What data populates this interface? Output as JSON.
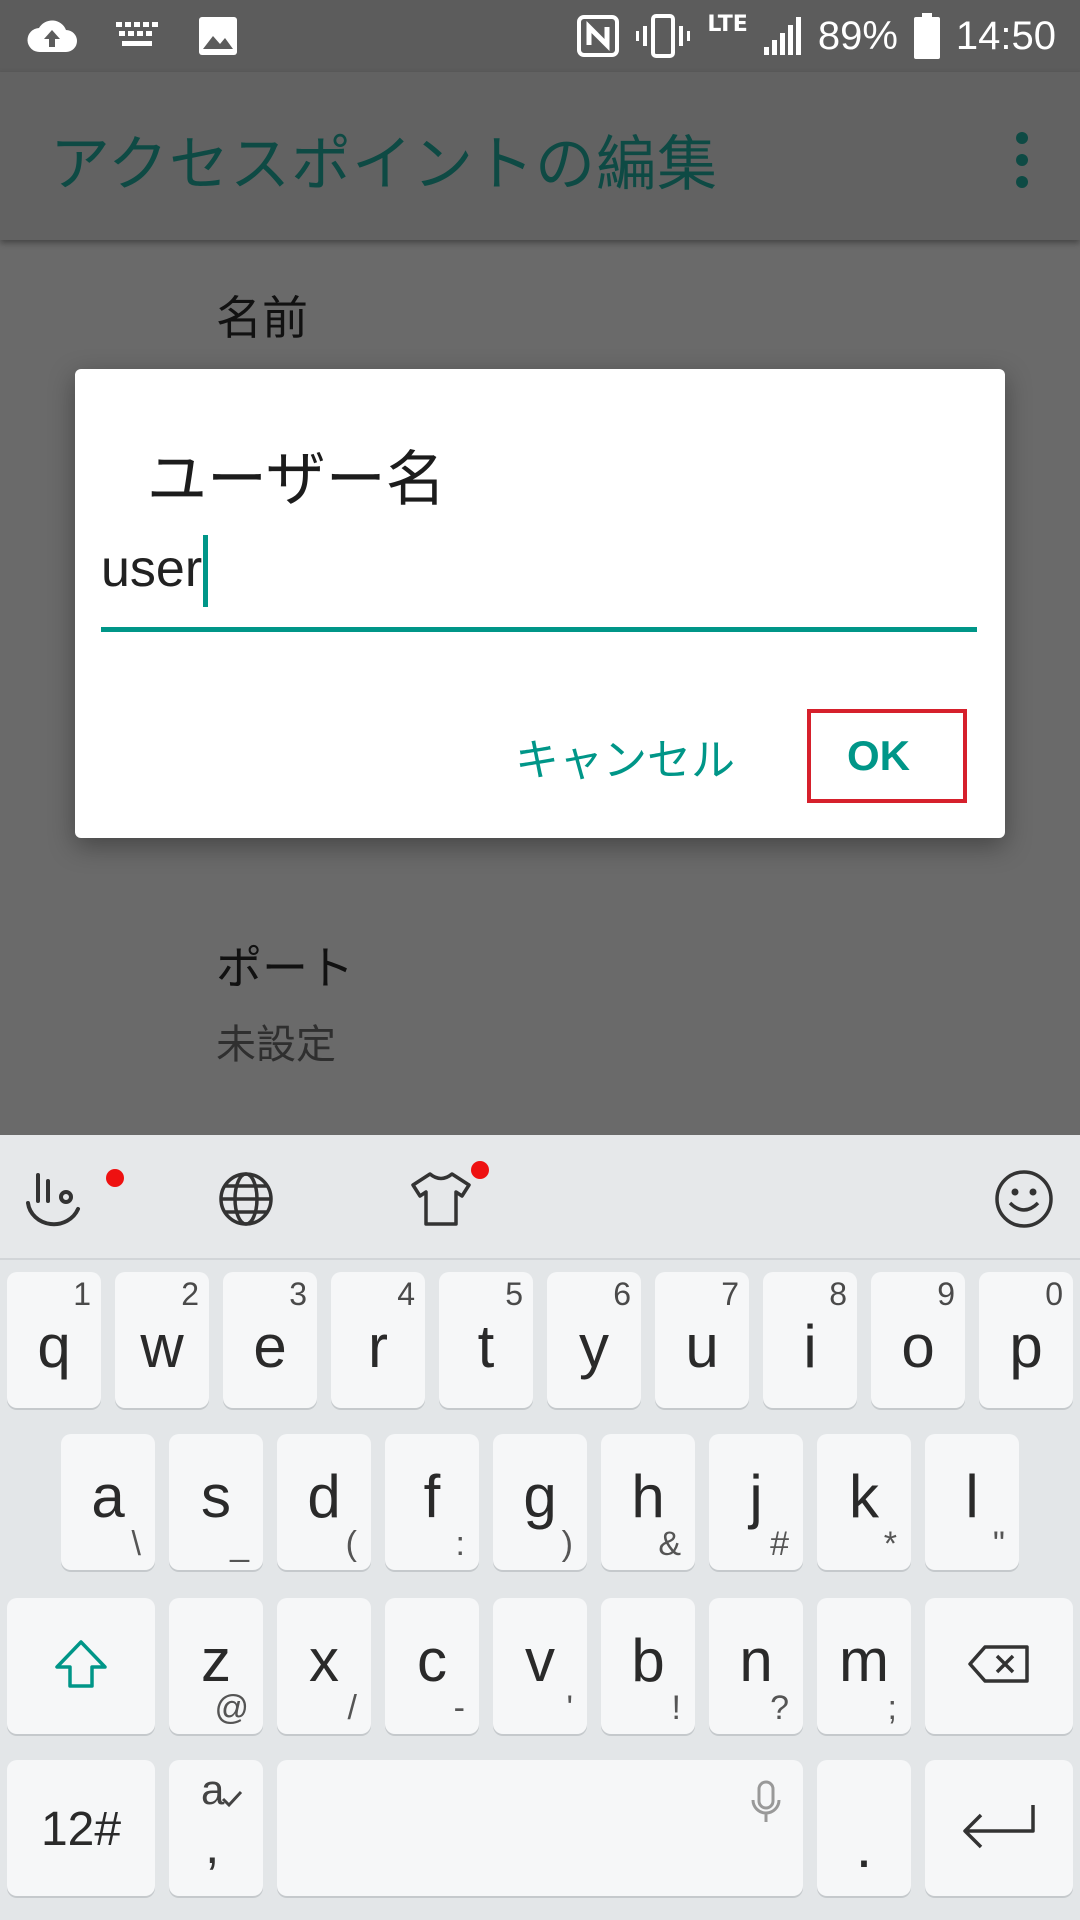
{
  "status_bar": {
    "battery": "89%",
    "time": "14:50",
    "network": "LTE"
  },
  "app_bar": {
    "title": "アクセスポイントの編集"
  },
  "preferences": [
    {
      "title": "名前",
      "summary": ""
    },
    {
      "title": "ポート",
      "summary": "未設定"
    }
  ],
  "dialog": {
    "title": "ユーザー名",
    "input_value": "user",
    "cancel_label": "キャンセル",
    "ok_label": "OK"
  },
  "keyboard": {
    "row1": [
      {
        "key": "q",
        "hint": "1"
      },
      {
        "key": "w",
        "hint": "2"
      },
      {
        "key": "e",
        "hint": "3"
      },
      {
        "key": "r",
        "hint": "4"
      },
      {
        "key": "t",
        "hint": "5"
      },
      {
        "key": "y",
        "hint": "6"
      },
      {
        "key": "u",
        "hint": "7"
      },
      {
        "key": "i",
        "hint": "8"
      },
      {
        "key": "o",
        "hint": "9"
      },
      {
        "key": "p",
        "hint": "0"
      }
    ],
    "row2": [
      {
        "key": "a",
        "hint": "\\"
      },
      {
        "key": "s",
        "hint": "_"
      },
      {
        "key": "d",
        "hint": "("
      },
      {
        "key": "f",
        "hint": ":"
      },
      {
        "key": "g",
        "hint": ")"
      },
      {
        "key": "h",
        "hint": "&"
      },
      {
        "key": "j",
        "hint": "#"
      },
      {
        "key": "k",
        "hint": "*"
      },
      {
        "key": "l",
        "hint": "\""
      }
    ],
    "row3": [
      {
        "key": "z",
        "hint": "@"
      },
      {
        "key": "x",
        "hint": "/"
      },
      {
        "key": "c",
        "hint": "-"
      },
      {
        "key": "v",
        "hint": "'"
      },
      {
        "key": "b",
        "hint": "!"
      },
      {
        "key": "n",
        "hint": "?"
      },
      {
        "key": "m",
        "hint": ";"
      }
    ],
    "symbols_label": "12#",
    "lang_key_top": "a",
    "lang_key_bottom": ",",
    "period_label": ".",
    "accent_color": "#009688"
  }
}
